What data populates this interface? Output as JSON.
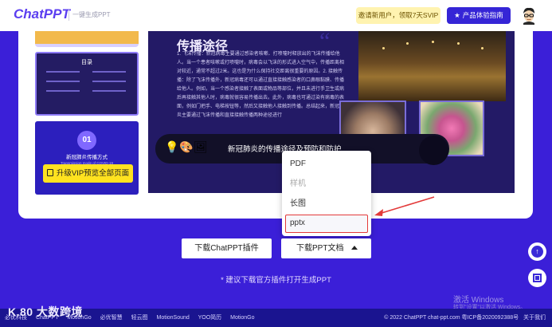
{
  "header": {
    "logo": "ChatPPT",
    "tagline": "一键生成PPT",
    "invite_label": "邀请新用户，领取7天SVIP",
    "guide_label": "产品体验指南"
  },
  "preview": {
    "thumb2_title": "目录",
    "thumb3_number": "01",
    "thumb3_title": "新冠肺炎传播方式",
    "thumb3_subtitle": "Transmission mode of COVID-19",
    "vip_label": "升级VIP预览全部页面",
    "slide_title": "传播途径",
    "slide_body": "1. 飞沫传播：新冠病毒主要通过感染者咳嗽、打喷嚏时释放出的飞沫传播给他人。当一个患者咳嗽或打喷嚏时，病毒会以飞沫的形式进入空气中，传播距离相对较近，通常不超过2米。这也是为什么保持社交距离很重要的原因。2. 接触传播：除了飞沫传播外，新冠病毒还可以通过直接接触感染者的口鼻眼黏膜、传播给他人。例如，当一个感染者接触了表面或物品等部位，并且未进行手卫生或病后再接触其他人时，病毒就很容易传播出去。此外，病毒也可通过染有病毒的表面，例如门把手、电梯按钮等，然后又接触他人接触到传播。总结起来，新冠肺炎主要通过飞沫传播和直接接触传播两种途径进行",
    "banner_text": "新冠肺炎的传播途径及预防和防护"
  },
  "dropdown": {
    "items": [
      {
        "label": "PDF",
        "disabled": false
      },
      {
        "label": "样机",
        "disabled": true
      },
      {
        "label": "长图",
        "disabled": false
      },
      {
        "label": "pptx",
        "disabled": false,
        "highlighted": true
      }
    ]
  },
  "actions": {
    "plugin_label": "下载ChatPPT插件",
    "ppt_label": "下载PPT文档",
    "hint": "* 建议下载官方插件打开生成PPT"
  },
  "windows_activation": {
    "line1": "激活 Windows",
    "line2": "转到\"设置\"以激活 Windows。"
  },
  "footer": {
    "links": [
      "必优科技",
      "ChatPPT",
      "MotionGo",
      "必优智慧",
      "轻云图",
      "MotionSound",
      "YOO简历",
      "MotionGo"
    ],
    "copyright": "© 2022 ChatPPT chat-ppt.com 粤ICP备2020092388号",
    "about": "关于我们"
  },
  "watermark": "K.80 大数跨境",
  "colors": {
    "brand": "#5b3ef0",
    "background": "#3b1fd8",
    "accent_yellow": "#ffe21f",
    "highlight_red": "#e33a3a"
  }
}
